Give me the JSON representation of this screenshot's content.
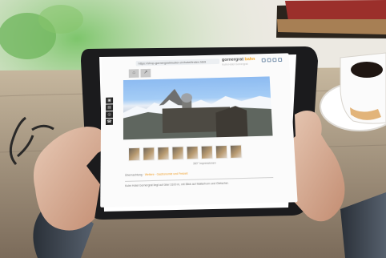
{
  "browser": {
    "url": "https://shop.gornergratmuster.ch/hotel/index.html"
  },
  "brand": {
    "name": "gornergrat",
    "suffix": "bahn",
    "subtitle": "Kulm Hotel Gornergrat"
  },
  "tabs": {
    "home_icon": "home-icon",
    "share_icon": "share-icon"
  },
  "toolbar_icons": [
    "cloud-icon",
    "download-icon",
    "info-icon",
    "menu-icon"
  ],
  "sidebar_icons": [
    "book-icon",
    "calendar-icon",
    "map-icon",
    "phone-icon"
  ],
  "gallery": {
    "caption": "360° Impressionen",
    "thumbs_count": 8
  },
  "content": {
    "tab1": "Übernachtung",
    "tab2": "Weitere",
    "tab3": "Gastronomie und Freizeit",
    "body_text": "Kulm Hotel Gornergrat liegt auf über 3100 m, mit Blick auf Matterhorn und Gletscher."
  },
  "colors": {
    "accent": "#ef9e26",
    "screen": "#fbfbfb"
  }
}
